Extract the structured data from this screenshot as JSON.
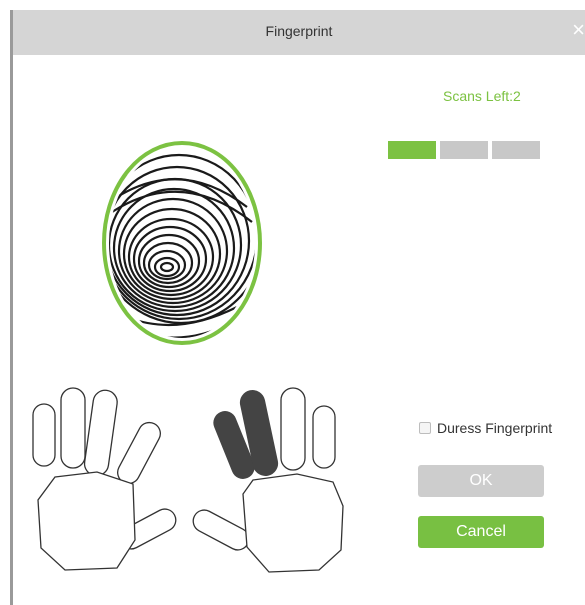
{
  "dialog": {
    "title": "Fingerprint",
    "close_glyph": "×"
  },
  "scans": {
    "label": "Scans Left:2",
    "progress_segments": [
      true,
      false,
      false
    ]
  },
  "fingerprint": {
    "icon": "fingerprint-image",
    "ring_color": "#7cc242"
  },
  "hands": {
    "selected_finger": "right-index",
    "selected_color": "#444444"
  },
  "duress": {
    "label": "Duress Fingerprint",
    "checked": false
  },
  "buttons": {
    "ok_label": "OK",
    "cancel_label": "Cancel"
  },
  "colors": {
    "accent": "#7cc242",
    "disabled": "#cdcdcd"
  }
}
